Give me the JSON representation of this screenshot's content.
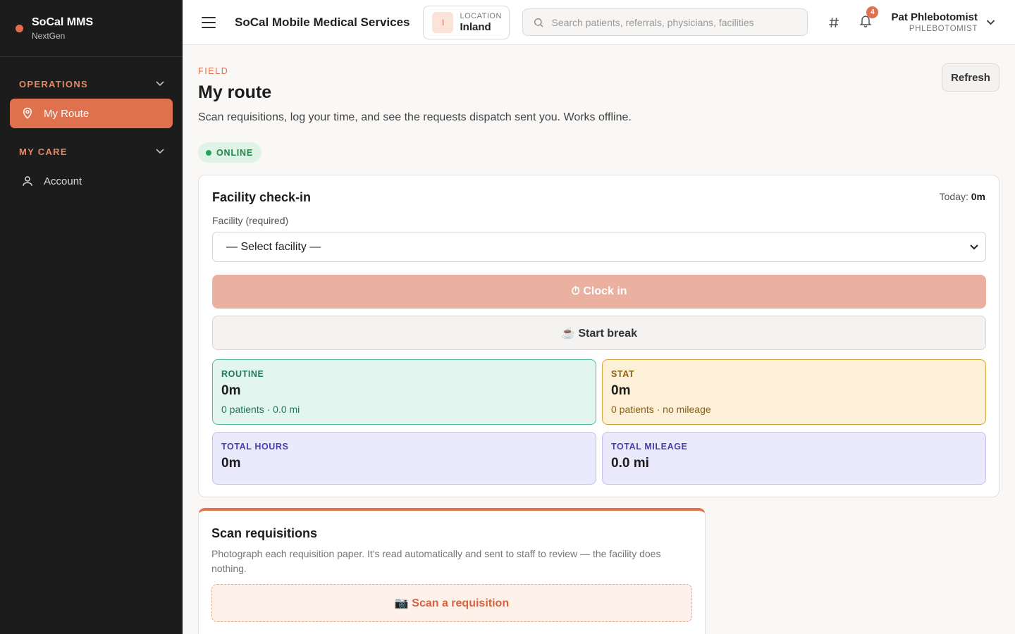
{
  "sidebar": {
    "brand_name": "SoCal MMS",
    "brand_sub": "NextGen",
    "sections": [
      {
        "label": "OPERATIONS",
        "items": [
          {
            "label": "My Route",
            "icon": "map-pin-icon",
            "active": true
          }
        ]
      },
      {
        "label": "MY CARE",
        "items": [
          {
            "label": "Account",
            "icon": "user-icon",
            "active": false
          }
        ]
      }
    ]
  },
  "header": {
    "app_title": "SoCal Mobile Medical Services",
    "location": {
      "badge": "I",
      "label": "LOCATION",
      "value": "Inland"
    },
    "search_placeholder": "Search patients, referrals, physicians, facilities",
    "notification_count": "4",
    "user": {
      "name": "Pat Phlebotomist",
      "role": "PHLEBOTOMIST"
    }
  },
  "page": {
    "eyebrow": "FIELD",
    "title": "My route",
    "subtitle": "Scan requisitions, log your time, and see the requests dispatch sent you. Works offline.",
    "refresh_label": "Refresh",
    "status": "ONLINE"
  },
  "checkin": {
    "title": "Facility check-in",
    "today_label": "Today:",
    "today_value": "0m",
    "field_label": "Facility (required)",
    "select_value": "— Select facility —",
    "clock_in_label": "⏱ Clock in",
    "break_label": "☕ Start break",
    "stats": {
      "routine": {
        "label": "ROUTINE",
        "value": "0m",
        "sub": "0 patients · 0.0 mi"
      },
      "stat": {
        "label": "STAT",
        "value": "0m",
        "sub": "0 patients · no mileage"
      },
      "total_hours": {
        "label": "TOTAL HOURS",
        "value": "0m"
      },
      "total_mileage": {
        "label": "TOTAL MILEAGE",
        "value": "0.0 mi"
      }
    }
  },
  "scan": {
    "title": "Scan requisitions",
    "description": "Photograph each requisition paper. It's read automatically and sent to staff to review — the facility does nothing.",
    "button_label": "📷 Scan a requisition"
  },
  "colors": {
    "accent": "#e0714f",
    "sidebar_bg": "#1c1c1c",
    "online": "#23a55a"
  }
}
